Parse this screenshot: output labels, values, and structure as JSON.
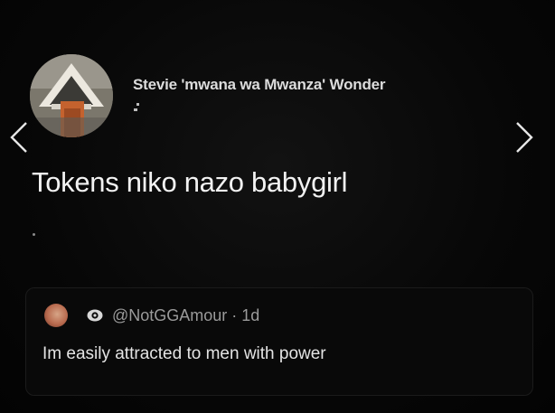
{
  "tweet": {
    "author_name": "Stevie 'mwana wa Mwanza' Wonder",
    "text": "Tokens niko nazo babygirl"
  },
  "quoted_tweet": {
    "handle_meta": "@NotGGAmour · 1d",
    "text": "Im easily attracted to men with power"
  },
  "icons": {
    "prev": "chevron-left-icon",
    "next": "chevron-right-icon",
    "visibility": "eye-icon"
  },
  "colors": {
    "background": "#050505",
    "text": "#f2f2f2",
    "muted": "#9a9a9a"
  }
}
